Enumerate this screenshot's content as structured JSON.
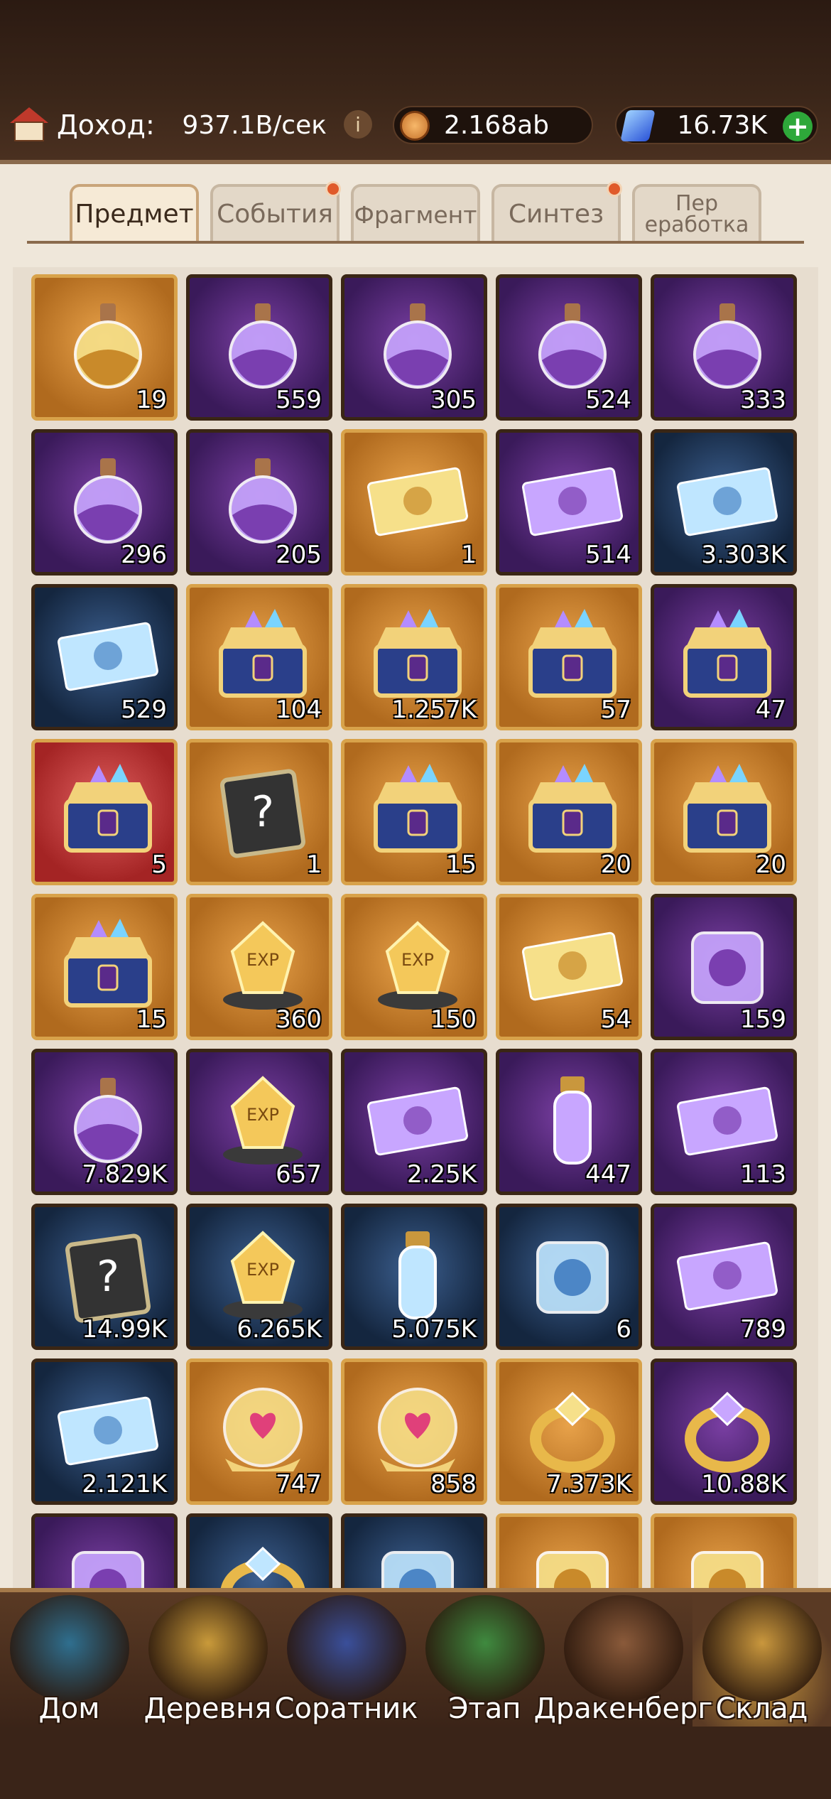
{
  "header": {
    "income_label": "Доход:",
    "income_value": "937.1B/сек",
    "coins_value": "2.168ab",
    "gems_value": "16.73K",
    "icons": [
      "house-icon",
      "info-icon",
      "coin-icon",
      "gem-icon",
      "plus-icon"
    ]
  },
  "tabs": [
    {
      "label": "Предмет",
      "active": true,
      "badge": false
    },
    {
      "label": "События",
      "active": false,
      "badge": true
    },
    {
      "label": "Фрагмент",
      "active": false,
      "badge": false
    },
    {
      "label": "Синтез",
      "active": false,
      "badge": true
    },
    {
      "label": "Пер\nеработка",
      "active": false,
      "badge": false
    }
  ],
  "items": [
    {
      "name": "rainbow-potion",
      "count": "19",
      "frame": "gold"
    },
    {
      "name": "blue-potion",
      "count": "559",
      "frame": "purple"
    },
    {
      "name": "purple-potion",
      "count": "305",
      "frame": "purple"
    },
    {
      "name": "yellow-potion",
      "count": "524",
      "frame": "purple"
    },
    {
      "name": "red-potion",
      "count": "333",
      "frame": "purple"
    },
    {
      "name": "purple-blue-potion",
      "count": "296",
      "frame": "purple"
    },
    {
      "name": "green-potion",
      "count": "205",
      "frame": "purple"
    },
    {
      "name": "gold-ticket",
      "count": "1",
      "frame": "gold"
    },
    {
      "name": "purple-ticket",
      "count": "514",
      "frame": "purple"
    },
    {
      "name": "blue-ticket",
      "count": "3.303K",
      "frame": "blue"
    },
    {
      "name": "pet-ticket",
      "count": "529",
      "frame": "blue"
    },
    {
      "name": "crystal-chest",
      "count": "104",
      "frame": "gold"
    },
    {
      "name": "gem-chest",
      "count": "1.257K",
      "frame": "gold"
    },
    {
      "name": "puzzle-chest",
      "count": "57",
      "frame": "gold"
    },
    {
      "name": "crown-chest",
      "count": "47",
      "frame": "purple"
    },
    {
      "name": "red-chest",
      "count": "5",
      "frame": "red"
    },
    {
      "name": "mystery-scroll",
      "count": "1",
      "frame": "gold"
    },
    {
      "name": "jewel-chest-1",
      "count": "15",
      "frame": "gold"
    },
    {
      "name": "jewel-chest-2",
      "count": "20",
      "frame": "gold"
    },
    {
      "name": "jewel-chest-3",
      "count": "20",
      "frame": "gold"
    },
    {
      "name": "jewel-chest-4",
      "count": "15",
      "frame": "gold"
    },
    {
      "name": "exp-crystal-large",
      "count": "360",
      "frame": "gold"
    },
    {
      "name": "exp-crystal-medium",
      "count": "150",
      "frame": "gold"
    },
    {
      "name": "gold-card",
      "count": "54",
      "frame": "gold"
    },
    {
      "name": "crystal-cushion",
      "count": "159",
      "frame": "purple"
    },
    {
      "name": "rainbow-flask",
      "count": "7.829K",
      "frame": "purple"
    },
    {
      "name": "exp-stone",
      "count": "657",
      "frame": "purple"
    },
    {
      "name": "silver-ticket",
      "count": "2.25K",
      "frame": "purple"
    },
    {
      "name": "green-vial",
      "count": "447",
      "frame": "purple"
    },
    {
      "name": "character-card",
      "count": "113",
      "frame": "purple"
    },
    {
      "name": "mystery-book",
      "count": "14.99K",
      "frame": "blue"
    },
    {
      "name": "exp-coin",
      "count": "6.265K",
      "frame": "blue"
    },
    {
      "name": "pink-vial",
      "count": "5.075K",
      "frame": "blue"
    },
    {
      "name": "milk-carton",
      "count": "6",
      "frame": "blue"
    },
    {
      "name": "time-coins-ticket",
      "count": "789",
      "frame": "purple"
    },
    {
      "name": "hourglass-ticket",
      "count": "2.121K",
      "frame": "blue"
    },
    {
      "name": "heart-orb",
      "count": "747",
      "frame": "gold"
    },
    {
      "name": "necklace-orb",
      "count": "858",
      "frame": "gold"
    },
    {
      "name": "gold-ring",
      "count": "7.373K",
      "frame": "gold"
    },
    {
      "name": "amethyst-ring",
      "count": "10.88K",
      "frame": "purple"
    },
    {
      "name": "pearl-necklace",
      "count": "",
      "frame": "purple"
    },
    {
      "name": "gold-band",
      "count": "",
      "frame": "blue"
    },
    {
      "name": "flower-wreath",
      "count": "",
      "frame": "blue"
    },
    {
      "name": "butler-outfit",
      "count": "",
      "frame": "gold"
    },
    {
      "name": "cauldron",
      "count": "",
      "frame": "gold"
    }
  ],
  "nav": [
    {
      "label": "Дом",
      "icon": "home-icon",
      "active": false
    },
    {
      "label": "Деревня",
      "icon": "village-icon",
      "active": false
    },
    {
      "label": "Соратник",
      "icon": "companion-icon",
      "active": false
    },
    {
      "label": "Этап",
      "icon": "stage-icon",
      "active": false
    },
    {
      "label": "Дракенберг",
      "icon": "castle-icon",
      "active": false
    },
    {
      "label": "Склад",
      "icon": "storage-icon",
      "active": true
    }
  ]
}
